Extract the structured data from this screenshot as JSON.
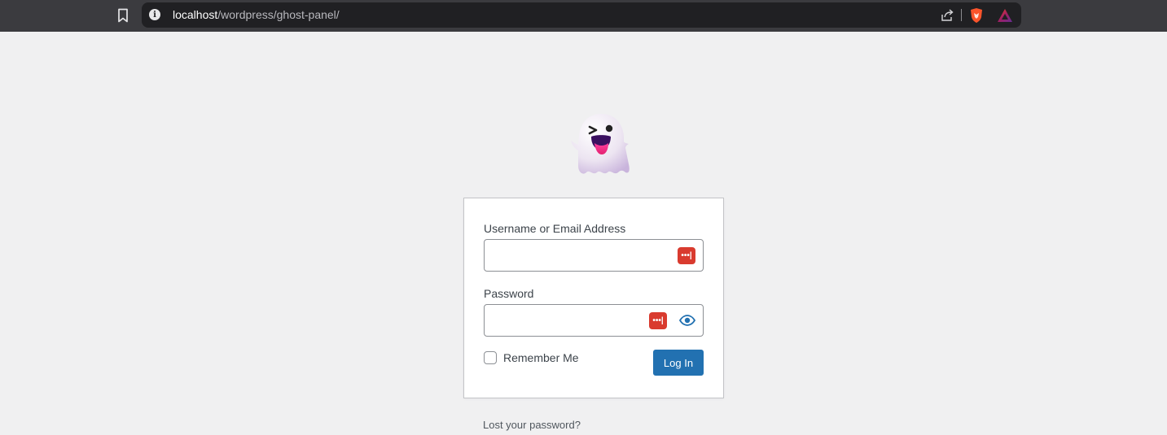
{
  "browser": {
    "url_host": "localhost",
    "url_path": "/wordpress/ghost-panel/",
    "icons": [
      "bookmark-icon",
      "info-icon",
      "share-icon",
      "brave-shields-icon",
      "brave-rewards-icon"
    ]
  },
  "login": {
    "logo_icon": "ghost-icon",
    "username_label": "Username or Email Address",
    "username_value": "",
    "password_label": "Password",
    "password_value": "",
    "password_manager_icon": "password-manager-icon",
    "show_password_icon": "eye-icon",
    "remember_label": "Remember Me",
    "remember_checked": false,
    "submit_label": "Log In",
    "lost_password_label": "Lost your password?"
  },
  "colors": {
    "page_bg": "#f0f0f1",
    "button_bg": "#2271b1",
    "password_manager": "#d93b2f",
    "chrome_bg": "#3b3b3f"
  }
}
